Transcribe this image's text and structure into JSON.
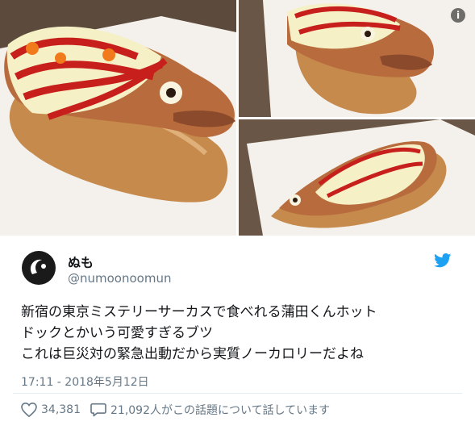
{
  "user": {
    "name": "ぬも",
    "handle": "@numoonoomun"
  },
  "tweet": {
    "lines": [
      "新宿の東京ミステリーサーカスで食べれる蒲田くんホット",
      "ドックとかいう可愛すぎるブツ",
      "これは巨災対の緊急出動だから実質ノーカロリーだよね"
    ],
    "timestamp": "17:11 - 2018年5月12日"
  },
  "stats": {
    "likes": "34,381",
    "talking": "21,092人がこの話題について話しています"
  },
  "icons": {
    "info": "info-icon",
    "bird": "twitter-bird-icon",
    "like": "heart-icon",
    "reply": "speech-bubble-icon"
  },
  "colors": {
    "brand": "#1da1f2",
    "muted": "#657786",
    "text": "#14171a"
  }
}
